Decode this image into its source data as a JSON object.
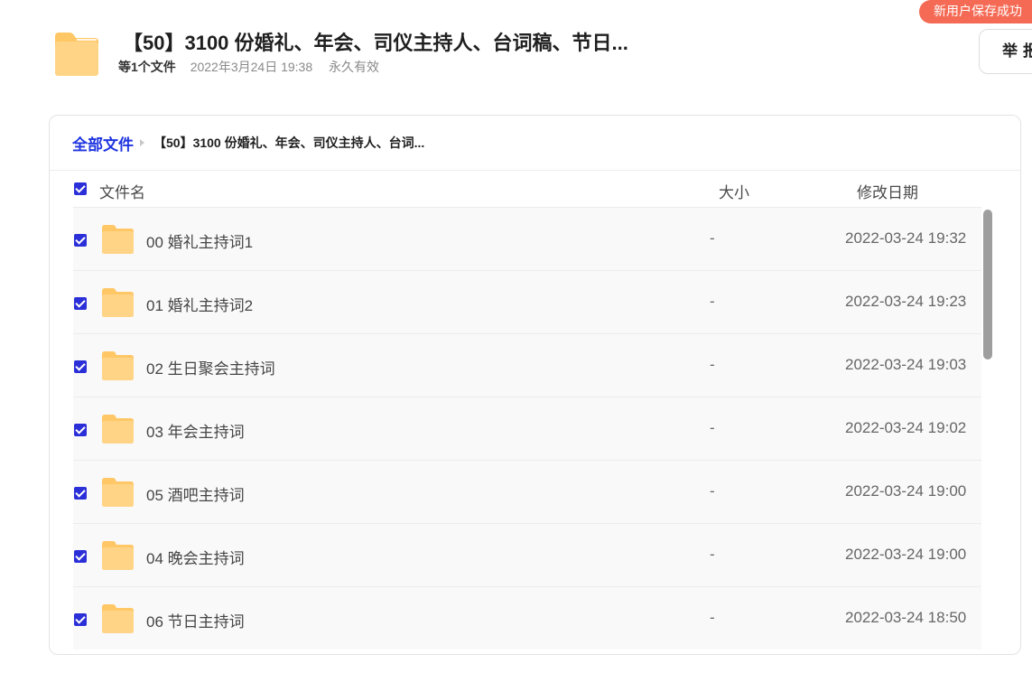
{
  "toast": {
    "text": "新用户保存成功"
  },
  "share": {
    "title": "【50】3100 份婚礼、年会、司仪主持人、台词稿、节日...",
    "file_count": "等1个文件",
    "date": "2022年3月24日 19:38",
    "validity": "永久有效",
    "report_label": "举报",
    "icon": "folder-icon"
  },
  "breadcrumb": {
    "root": "全部文件",
    "current": "【50】3100 份婚礼、年会、司仪主持人、台词..."
  },
  "columns": {
    "name": "文件名",
    "size": "大小",
    "date": "修改日期"
  },
  "files": [
    {
      "name": "00 婚礼主持词1",
      "size": "-",
      "date": "2022-03-24 19:32",
      "checked": true
    },
    {
      "name": "01 婚礼主持词2",
      "size": "-",
      "date": "2022-03-24 19:23",
      "checked": true
    },
    {
      "name": "02 生日聚会主持词",
      "size": "-",
      "date": "2022-03-24 19:03",
      "checked": true
    },
    {
      "name": "03 年会主持词",
      "size": "-",
      "date": "2022-03-24 19:02",
      "checked": true
    },
    {
      "name": "05 酒吧主持词",
      "size": "-",
      "date": "2022-03-24 19:00",
      "checked": true
    },
    {
      "name": "04 晚会主持词",
      "size": "-",
      "date": "2022-03-24 19:00",
      "checked": true
    },
    {
      "name": "06 节日主持词",
      "size": "-",
      "date": "2022-03-24 18:50",
      "checked": true
    }
  ],
  "colors": {
    "accent": "#2b2fd8",
    "link": "#1f35e0",
    "toast": "#f56a55",
    "folder": "#ffc766"
  }
}
